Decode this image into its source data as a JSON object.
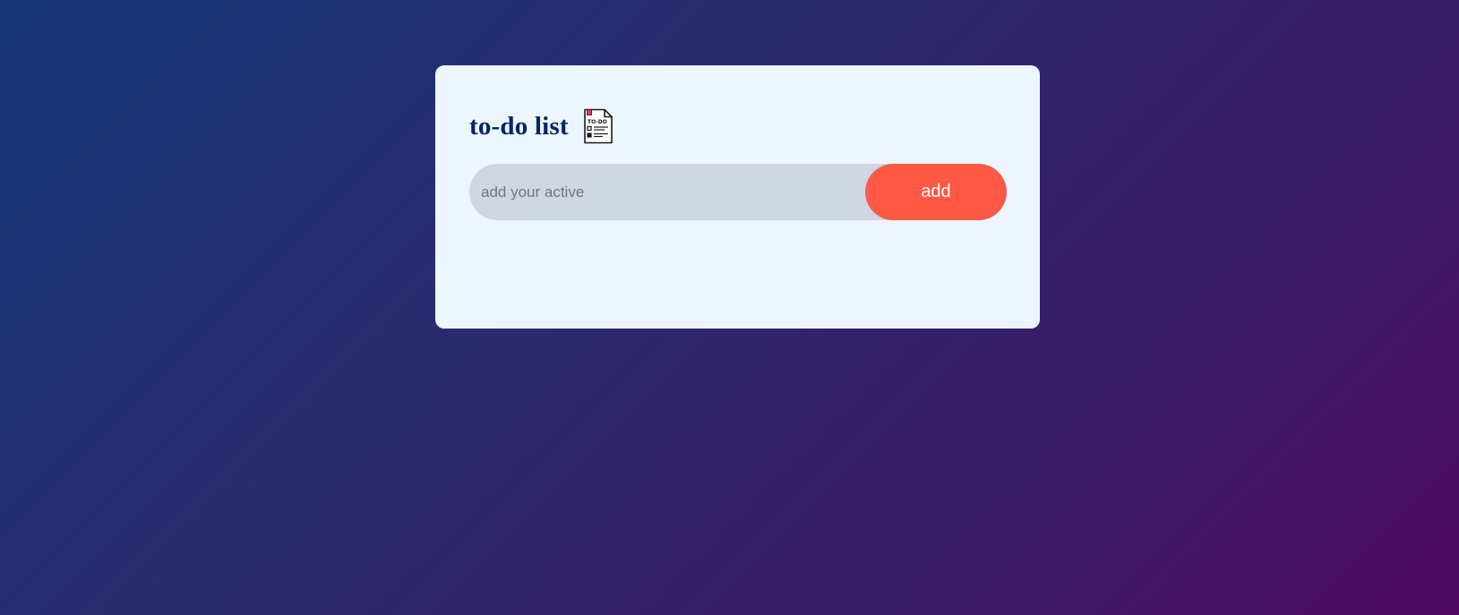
{
  "app": {
    "title": "to-do list",
    "title_icon": "todo-checklist-icon"
  },
  "input": {
    "placeholder": "add your active",
    "value": ""
  },
  "actions": {
    "add_label": "add"
  },
  "tasks": [],
  "colors": {
    "background_start": "#153677",
    "background_end": "#4e085f",
    "card": "#edf5fe",
    "title": "#002765",
    "input_bg": "#cfd6e4",
    "add_button": "#ff5945"
  }
}
